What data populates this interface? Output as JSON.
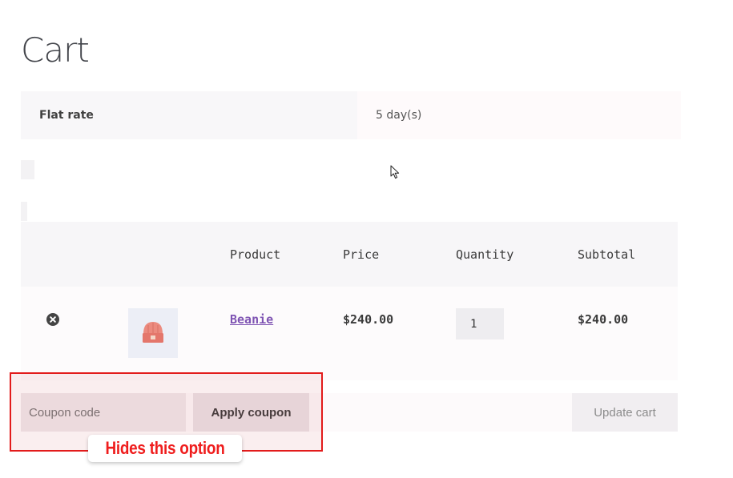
{
  "page": {
    "title": "Cart"
  },
  "shipping": {
    "method": "Flat rate",
    "delivery_time": "5 day(s)"
  },
  "table": {
    "headers": [
      "",
      "",
      "Product",
      "Price",
      "Quantity",
      "Subtotal"
    ],
    "rows": [
      {
        "product": "Beanie",
        "price": "$240.00",
        "quantity": "1",
        "subtotal": "$240.00",
        "thumbnail_icon": "beanie-hat-icon",
        "remove_icon": "remove-circle-icon"
      }
    ]
  },
  "actions": {
    "coupon_placeholder": "Coupon code",
    "apply_label": "Apply coupon",
    "update_label": "Update cart"
  },
  "annotation": {
    "label": "Hides this option",
    "color": "#e21b1b"
  },
  "colors": {
    "link": "#7f54b3",
    "annotation_red": "#e21b1b"
  }
}
